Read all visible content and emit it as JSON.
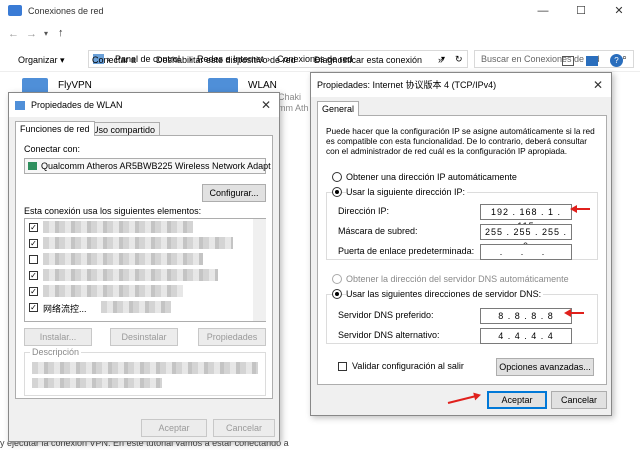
{
  "window": {
    "title": "Conexiones de red"
  },
  "breadcrumb": {
    "parts": [
      "Panel de control",
      "Redes e Internet",
      "Conexiones de red"
    ]
  },
  "search": {
    "placeholder": "Buscar en Conexiones de red"
  },
  "toolbar": {
    "organize": "Organizar ▾",
    "connect": "Conectar a",
    "disable": "Deshabilitar este dispositivo de red",
    "diagnose": "Diagnosticar esta conexión",
    "rename": "»"
  },
  "connections": [
    {
      "name": "FlyVPN"
    },
    {
      "name": "WLAN",
      "sub1": "Chaki",
      "sub2": "mm Ath"
    }
  ],
  "footer_text": "y ejecutar la conexión VPN. En este tutorial vamos a estar conectando a",
  "wlan_dialog": {
    "title": "Propiedades de WLAN",
    "tabs": [
      "Funciones de red",
      "Uso compartido"
    ],
    "connect_using": "Conectar con:",
    "adapter": "Qualcomm Atheros AR5BWB225 Wireless Network Adapt",
    "configure": "Configurar...",
    "items_label": "Esta conexión usa los siguientes elementos:",
    "item_fragment": "网络流控...",
    "install": "Instalar...",
    "uninstall": "Desinstalar",
    "properties": "Propiedades",
    "description": "Descripción",
    "ok": "Aceptar",
    "cancel": "Cancelar"
  },
  "ipv4_dialog": {
    "title": "Propiedades: Internet 协议版本 4 (TCP/IPv4)",
    "tab": "General",
    "intro": "Puede hacer que la configuración IP se asigne automáticamente si la red es compatible con esta funcionalidad. De lo contrario, deberá consultar con el administrador de red cuál es la configuración IP apropiada.",
    "auto_ip": "Obtener una dirección IP automáticamente",
    "use_ip": "Usar la siguiente dirección IP:",
    "ip_label": "Dirección IP:",
    "ip_value": "192 . 168 . 1 . 115",
    "mask_label": "Máscara de subred:",
    "mask_value": "255 . 255 . 255 . 0",
    "gateway_label": "Puerta de enlace predeterminada:",
    "gateway_value": ". . .",
    "auto_dns": "Obtener la dirección del servidor DNS automáticamente",
    "use_dns": "Usar las siguientes direcciones de servidor DNS:",
    "dns1_label": "Servidor DNS preferido:",
    "dns1_value": "8 . 8 . 8 . 8",
    "dns2_label": "Servidor DNS alternativo:",
    "dns2_value": "4 . 4 . 4 . 4",
    "validate": "Validar configuración al salir",
    "advanced": "Opciones avanzadas...",
    "ok": "Aceptar",
    "cancel": "Cancelar"
  },
  "colors": {
    "accent": "#0078d7",
    "arrow": "#e0201c"
  }
}
